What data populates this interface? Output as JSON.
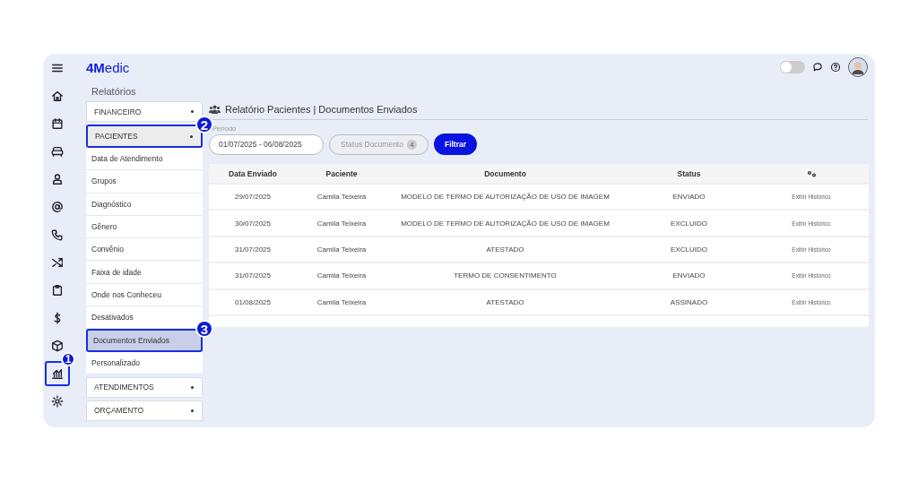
{
  "header": {
    "logo": "**4M**edic",
    "toggle": {
      "on": false
    }
  },
  "rail": [
    {
      "selected": false
    },
    {
      "selected": false
    },
    {
      "selected": false
    },
    {
      "selected": false
    },
    {
      "selected": false
    },
    {
      "selected": false
    },
    {
      "selected": false
    },
    {
      "selected": false
    },
    {
      "selected": false
    },
    {
      "selected": false
    },
    {
      "selected": false
    },
    {
      "selected": true,
      "callout": "1"
    },
    {
      "selected": false
    }
  ],
  "breadcrumb": "Relatórios",
  "menu": [
    {
      "label": "FINANCEIRO",
      "expanded": false
    },
    {
      "label": "PACIENTES",
      "expanded": true,
      "callout": "2",
      "children": [
        {
          "label": "Data de Atendimento",
          "selected": false
        },
        {
          "label": "Grupos",
          "selected": false
        },
        {
          "label": "Diagnóstico",
          "selected": false
        },
        {
          "label": "Gênero",
          "selected": false
        },
        {
          "label": "Convênio",
          "selected": false
        },
        {
          "label": "Faixa de idade",
          "selected": false
        },
        {
          "label": "Onde nos Conheceu",
          "selected": false
        },
        {
          "label": "Desativados",
          "selected": false
        },
        {
          "label": "Documentos Enviados",
          "selected": true,
          "callout": "3"
        },
        {
          "label": "Personalizado",
          "selected": false
        }
      ]
    },
    {
      "label": "ATENDIMENTOS",
      "expanded": false
    },
    {
      "label": "ORÇAMENTO",
      "expanded": false
    }
  ],
  "report": {
    "title": "Relatório Pacientes | Documentos Enviados",
    "period": {
      "label": "Período",
      "value": "01/07/2025 - 06/08/2025"
    },
    "status_filter": {
      "label": "Status Documento",
      "count": "4"
    },
    "filter_button": "Filtrar"
  },
  "table": {
    "columns": [
      "Data Enviado",
      "Paciente",
      "Documento",
      "Status"
    ],
    "rows": [
      [
        "29/07/2025",
        "Camila Teixeira",
        "MODELO DE TERMO DE AUTORIZAÇÃO DE USO DE IMAGEM",
        "ENVIADO",
        "Exibir Histórico"
      ],
      [
        "30/07/2025",
        "Camila Teixeira",
        "MODELO DE TERMO DE AUTORIZAÇÃO DE USO DE IMAGEM",
        "EXCLUIDO",
        "Exibir Histórico"
      ],
      [
        "31/07/2025",
        "Camila Teixeira",
        "ATESTADO",
        "EXCLUIDO",
        "Exibir Histórico"
      ],
      [
        "31/07/2025",
        "Camila Teixeira",
        "TERMO DE CONSENTIMENTO",
        "ENVIADO",
        "Exibir Histórico"
      ],
      [
        "01/08/2025",
        "Camila Teixeira",
        "ATESTADO",
        "ASSINADO",
        "Exibir Histórico"
      ]
    ]
  }
}
